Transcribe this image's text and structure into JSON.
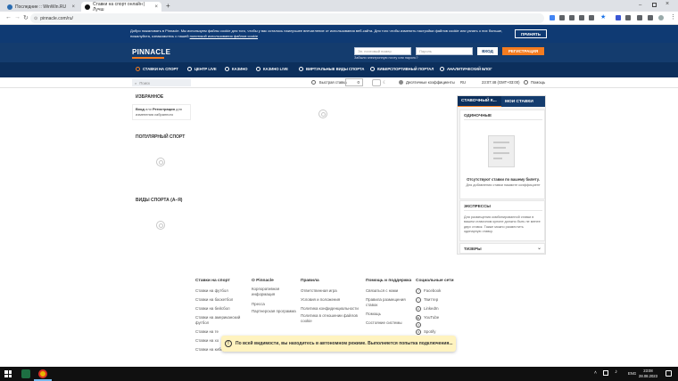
{
  "browser": {
    "tabs": [
      {
        "title": "Последние :: WinWin.RU",
        "active": false
      },
      {
        "title": "Ставки на спорт онлайн | Лучш",
        "active": true
      }
    ],
    "new_tab": "+",
    "url": "pinnacle.com/ru/"
  },
  "cookie": {
    "text1": "Добро пожаловать в Pinnacle. Мы используем файлы cookie для того, чтобы у вас осталось наилучшее впечатление от использования веб-сайта. Для того чтобы изменить настройки файлов cookie или узнать о них больше, пожалуйста, ознакомьтесь с нашей",
    "link": "политикой использования файлов cookie",
    "accept": "ПРИНЯТЬ"
  },
  "login": {
    "logo": "PINNACLE",
    "user_placeholder": "Эл. почтовый номер",
    "pass_placeholder": "Пароль",
    "login_btn": "ВХОД",
    "register_btn": "РЕГИСТРАЦИЯ",
    "forgot": "Забыли электронную почту или пароль?"
  },
  "nav": [
    {
      "label": "СТАВКИ НА СПОРТ",
      "icon": "sport-icon"
    },
    {
      "label": "ЦЕНТР LIVE",
      "icon": "live-icon"
    },
    {
      "label": "КАЗИНО",
      "icon": "casino-icon"
    },
    {
      "label": "КАЗИНО LIVE",
      "icon": "casino-live-icon"
    },
    {
      "label": "ВИРТУАЛЬНЫЕ ВИДЫ СПОРТА",
      "icon": "virtual-icon"
    },
    {
      "label": "КИБЕРСПОРТИВНЫЙ ПОРТАЛ",
      "icon": "esports-icon"
    },
    {
      "label": "АНАЛИТИЧЕСКИЙ БЛОГ",
      "icon": "blog-icon"
    }
  ],
  "subbar": {
    "search_placeholder": "Поиск",
    "quick_bet": "Быстрая ставка",
    "quick_value": "0",
    "odds_format": "Десятичные коэффициенты",
    "lang": "RU",
    "time": "23:07:48 (GMT+03:00)",
    "help": "Помощь"
  },
  "main": {
    "favorites": "ИЗБРАННОЕ",
    "fav_login": "Вход",
    "fav_or": "или",
    "fav_register": "Регистрация",
    "fav_text": "для изменения избранного",
    "popular": "ПОПУЛЯРНЫЙ СПОРТ",
    "sports_az": "ВИДЫ СПОРТА (А–Я)"
  },
  "betslip": {
    "tab1": "СТАВОЧНЫЙ К...",
    "tab2": "МОИ СТАВКИ",
    "singles": "ОДИНОЧНЫЕ",
    "empty_title": "Отсутствуют ставки по вашему билету.",
    "empty_sub": "Для добавления ставки нажмите коэффициент",
    "express": "ЭКСПРЕССЫ",
    "express_text": "Для размещения комбинированной ставки в вашем ставочном купоне должно быть не менее двух ставок. Также можно разместить одинарную ставку.",
    "teasers": "ТИЗЕРЫ"
  },
  "footer": {
    "cols": [
      {
        "title": "Ставки на спорт",
        "items": [
          "Ставки на футбол",
          "Ставки на баскетбол",
          "Ставки на бейсбол",
          "Ставки на американский футбол",
          "Ставки на те",
          "Ставки на хо",
          "Ставки на киберспорт"
        ]
      },
      {
        "title": "О Pinnacle",
        "items": [
          "Корпоративная информация",
          "Пресса",
          "Партнерская программа"
        ]
      },
      {
        "title": "Правила",
        "items": [
          "Ответственная игра",
          "Условия и положения",
          "Политика конфиденциальности",
          "Политика в отношении файлов cookie"
        ]
      },
      {
        "title": "Помощь и поддержка",
        "items": [
          "Связаться с нами",
          "Правила размещения ставок",
          "Помощь",
          "Состояние системы"
        ]
      },
      {
        "title": "Социальные сети",
        "items": [
          "Facebook",
          "Твиттер",
          "LinkedIn",
          "YouTube",
          "",
          "Spotify",
          "SoundCloud"
        ]
      }
    ]
  },
  "offline_msg": "По всей видимости, вы находитесь в автономном режиме. Выполняется попытка подключения...",
  "taskbar": {
    "lang": "ENG",
    "time": "23:08",
    "date": "28.08.2023"
  },
  "colors": {
    "navy": "#143c6e",
    "accent": "#f47c20"
  }
}
